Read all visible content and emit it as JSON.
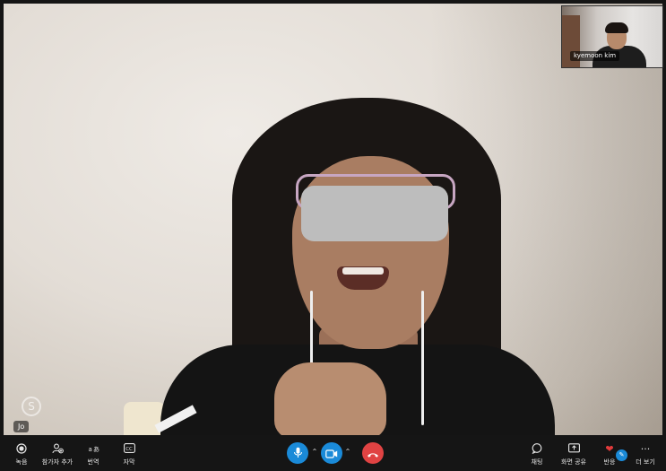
{
  "participant": {
    "name": "Jo"
  },
  "self_view": {
    "name": "kyemoon kim"
  },
  "toolbar_left": [
    {
      "key": "record",
      "label": "녹음",
      "icon": "record-icon"
    },
    {
      "key": "add-participant",
      "label": "참가자 추가",
      "icon": "add-person-icon"
    },
    {
      "key": "translate",
      "label": "번역",
      "icon": "translate-icon"
    },
    {
      "key": "subtitles",
      "label": "자막",
      "icon": "cc-icon"
    }
  ],
  "toolbar_right": [
    {
      "key": "chat",
      "label": "채팅",
      "icon": "chat-icon"
    },
    {
      "key": "share-screen",
      "label": "화면 공유",
      "icon": "share-screen-icon"
    },
    {
      "key": "react",
      "label": "반응",
      "icon": "heart-icon"
    },
    {
      "key": "more",
      "label": "더 보기",
      "icon": "more-icon"
    }
  ],
  "colors": {
    "accent": "#1a8ad8",
    "end_call": "#e04343",
    "toolbar_bg": "#151515",
    "heart": "#e23b3b"
  }
}
